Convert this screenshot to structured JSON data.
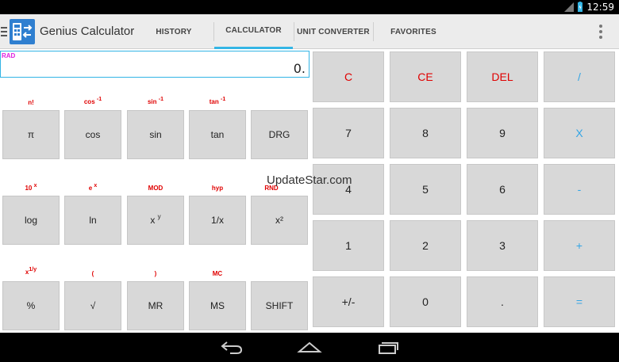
{
  "status_bar": {
    "time": "12:59",
    "battery_icon": "battery-charging-icon",
    "signal_icon": "signal-icon"
  },
  "action_bar": {
    "app_icon": "calculator-icon",
    "title": "Genius Calculator",
    "tabs": [
      {
        "label": "HISTORY",
        "active": false
      },
      {
        "label": "CALCULATOR",
        "active": true
      },
      {
        "label": "UNIT CONVERTER",
        "active": false
      },
      {
        "label": "FAVORITES",
        "active": false
      }
    ],
    "overflow_icon": "overflow-menu-icon"
  },
  "display": {
    "mode": "RAD",
    "value": "0."
  },
  "scientific": {
    "row1": {
      "secondary": [
        "n!",
        "cos",
        "sin",
        "tan",
        ""
      ],
      "secondary_sup": [
        "",
        "-1",
        "-1",
        "-1",
        ""
      ],
      "keys": [
        "π",
        "cos",
        "sin",
        "tan",
        "DRG"
      ]
    },
    "row2": {
      "secondary": [
        "10",
        "e",
        "MOD",
        "hyp",
        "RND"
      ],
      "secondary_sup": [
        "x",
        "x",
        "",
        "",
        ""
      ],
      "keys": [
        "log",
        "ln",
        "x",
        "1/x",
        "x²"
      ],
      "keys_sup": [
        "",
        "",
        "y",
        "",
        ""
      ]
    },
    "row3": {
      "secondary": [
        "x",
        "(",
        ")",
        "MC",
        ""
      ],
      "secondary_sup": [
        "1/y",
        "",
        "",
        "",
        ""
      ],
      "keys": [
        "%",
        "√",
        "MR",
        "MS",
        "SHIFT"
      ]
    }
  },
  "keypad": {
    "rows": [
      [
        "C",
        "CE",
        "DEL",
        "/"
      ],
      [
        "7",
        "8",
        "9",
        "X"
      ],
      [
        "4",
        "5",
        "6",
        "-"
      ],
      [
        "1",
        "2",
        "3",
        "+"
      ],
      [
        "+/-",
        "0",
        ".",
        "="
      ]
    ]
  },
  "watermark": "UpdateStar.com",
  "colors": {
    "accent": "#33b5e5",
    "secondary_red": "#e00000",
    "operator_blue": "#33a5e5",
    "rad_magenta": "#e020e0"
  },
  "nav_bar": {
    "icons": [
      "back-icon",
      "home-icon",
      "recent-apps-icon"
    ]
  }
}
